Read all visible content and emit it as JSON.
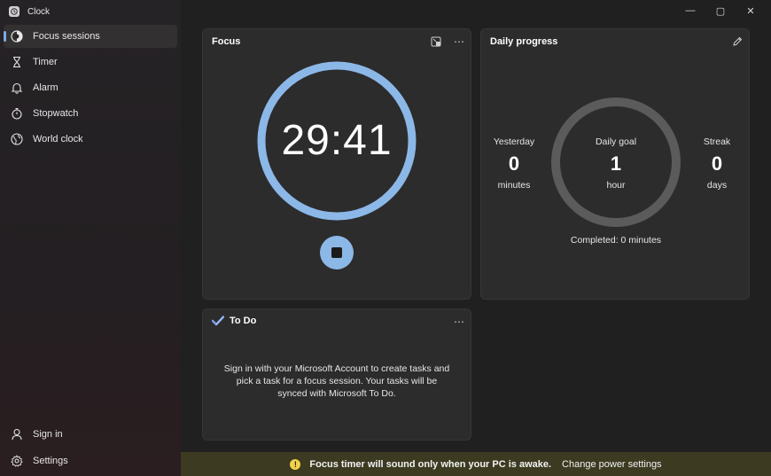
{
  "window": {
    "title": "Clock",
    "controls": {
      "minimize": "—",
      "maximize": "▢",
      "close": "✕"
    }
  },
  "sidebar": {
    "items": [
      {
        "label": "Focus sessions",
        "icon": "focus-icon",
        "active": true
      },
      {
        "label": "Timer",
        "icon": "hourglass-icon"
      },
      {
        "label": "Alarm",
        "icon": "bell-icon"
      },
      {
        "label": "Stopwatch",
        "icon": "stopwatch-icon"
      },
      {
        "label": "World clock",
        "icon": "globe-icon"
      }
    ],
    "footer": [
      {
        "label": "Sign in",
        "icon": "person-icon"
      },
      {
        "label": "Settings",
        "icon": "gear-icon"
      }
    ]
  },
  "focus": {
    "title": "Focus",
    "time": "29:41",
    "accent": "#8cb8e8"
  },
  "daily_progress": {
    "title": "Daily progress",
    "yesterday": {
      "label": "Yesterday",
      "value": "0",
      "unit": "minutes"
    },
    "goal": {
      "label": "Daily goal",
      "value": "1",
      "unit": "hour"
    },
    "streak": {
      "label": "Streak",
      "value": "0",
      "unit": "days"
    },
    "completed": "Completed: 0 minutes"
  },
  "todo": {
    "title": "To Do",
    "message": "Sign in with your Microsoft Account to create tasks and pick a task for a focus session. Your tasks will be synced with Microsoft To Do."
  },
  "banner": {
    "message": "Focus timer will sound only when your PC is awake.",
    "link": "Change power settings",
    "icon": "!"
  }
}
